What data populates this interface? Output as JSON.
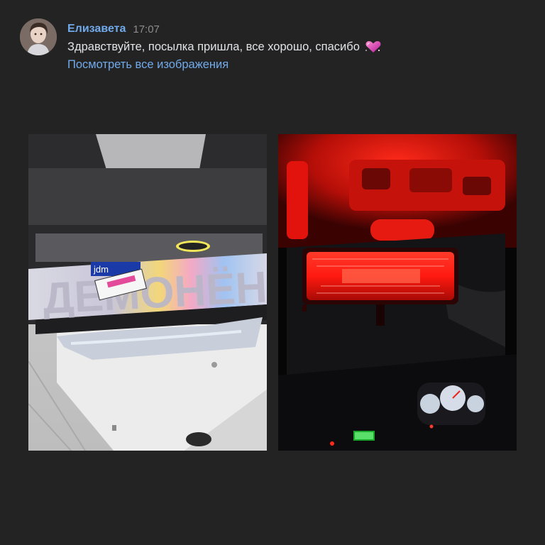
{
  "message": {
    "author": "Елизавета",
    "time": "17:07",
    "text": "Здравствуйте, посылка пришла, все хорошо, спасибо",
    "emoji": "sparkling-heart",
    "view_all_link": "Посмотреть все изображения"
  },
  "photos": [
    {
      "subject": "box-with-sticker",
      "sticker_text": "ДЕМОНЁНОК",
      "tag_text": "jdm"
    },
    {
      "subject": "car-interior-red-led-mirror"
    }
  ],
  "colors": {
    "background": "#232323",
    "author_link": "#71aaeb",
    "text": "#e1e3e6",
    "time": "#8c8c8c"
  }
}
